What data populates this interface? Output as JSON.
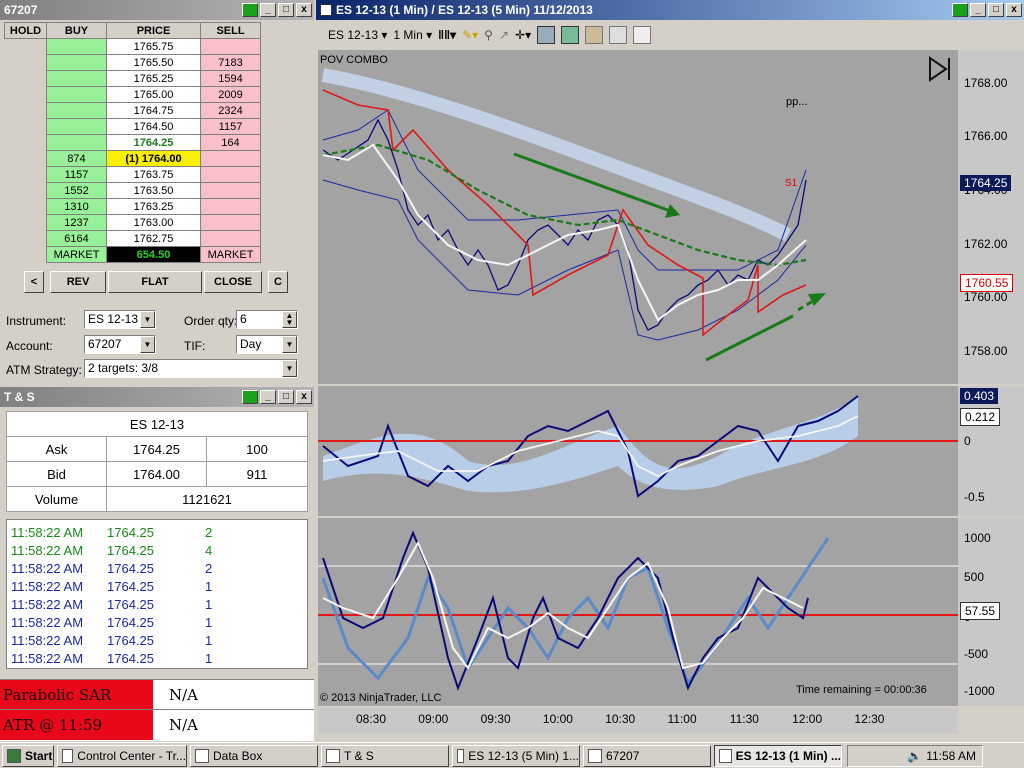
{
  "dom_window": {
    "title": "67207",
    "headers": [
      "HOLD",
      "BUY",
      "PRICE",
      "SELL"
    ],
    "rows": [
      {
        "buy": "",
        "price": "1765.75",
        "sell": ""
      },
      {
        "buy": "",
        "price": "1765.50",
        "sell": "7183"
      },
      {
        "buy": "",
        "price": "1765.25",
        "sell": "1594"
      },
      {
        "buy": "",
        "price": "1765.00",
        "sell": "2009"
      },
      {
        "buy": "",
        "price": "1764.75",
        "sell": "2324"
      },
      {
        "buy": "",
        "price": "1764.50",
        "sell": "1157"
      },
      {
        "buy": "",
        "price": "1764.25",
        "sell": "164"
      },
      {
        "buy": "874",
        "price": "(1) 1764.00",
        "sell": ""
      },
      {
        "buy": "1157",
        "price": "1763.75",
        "sell": ""
      },
      {
        "buy": "1552",
        "price": "1763.50",
        "sell": ""
      },
      {
        "buy": "1310",
        "price": "1763.25",
        "sell": ""
      },
      {
        "buy": "1237",
        "price": "1763.00",
        "sell": ""
      },
      {
        "buy": "6164",
        "price": "1762.75",
        "sell": ""
      }
    ],
    "market_buy": "MARKET",
    "pnl": "654.50",
    "market_sell": "MARKET",
    "buttons": {
      "left": "<",
      "rev": "REV",
      "flat": "FLAT",
      "close": "CLOSE",
      "c": "C"
    },
    "instrument_label": "Instrument:",
    "instrument": "ES 12-13",
    "order_qty_label": "Order qty:",
    "order_qty": "6",
    "account_label": "Account:",
    "account": "67207",
    "tif_label": "TIF:",
    "tif": "Day",
    "atm_label": "ATM Strategy:",
    "atm": "2 targets: 3/8"
  },
  "ts_window": {
    "title": "T & S",
    "instrument": "ES 12-13",
    "ask_label": "Ask",
    "ask_price": "1764.25",
    "ask_size": "100",
    "bid_label": "Bid",
    "bid_price": "1764.00",
    "bid_size": "911",
    "volume_label": "Volume",
    "volume": "1121621",
    "trades": [
      {
        "time": "11:58:22 AM",
        "price": "1764.25",
        "size": "2",
        "color": "#1a8a1a"
      },
      {
        "time": "11:58:22 AM",
        "price": "1764.25",
        "size": "4",
        "color": "#1a8a1a"
      },
      {
        "time": "11:58:22 AM",
        "price": "1764.25",
        "size": "2",
        "color": "#1a2aa0"
      },
      {
        "time": "11:58:22 AM",
        "price": "1764.25",
        "size": "1",
        "color": "#1a2aa0"
      },
      {
        "time": "11:58:22 AM",
        "price": "1764.25",
        "size": "1",
        "color": "#1a2aa0"
      },
      {
        "time": "11:58:22 AM",
        "price": "1764.25",
        "size": "1",
        "color": "#1a2aa0"
      },
      {
        "time": "11:58:22 AM",
        "price": "1764.25",
        "size": "1",
        "color": "#1a2aa0"
      },
      {
        "time": "11:58:22 AM",
        "price": "1764.25",
        "size": "1",
        "color": "#1a2aa0"
      }
    ]
  },
  "databox": {
    "rows": [
      {
        "label": "Parabolic SAR",
        "value": "N/A"
      },
      {
        "label": "ATR @ 11:59",
        "value": "N/A"
      }
    ]
  },
  "chart_window": {
    "title": "ES 12-13 (1 Min) / ES 12-13 (5 Min)  11/12/2013",
    "toolbar": {
      "instrument": "ES 12-13",
      "interval": "1 Min"
    },
    "label_pov": "POV COMBO",
    "label_pp": "pp...",
    "label_s1": "S1",
    "price_ticks": [
      "1768.00",
      "1766.00",
      "1764.00",
      "1762.00",
      "1760.00",
      "1758.00"
    ],
    "last_price": "1764.25",
    "red_price": "1760.55",
    "osc1_ticks": [
      "0",
      "-0.5"
    ],
    "osc1_val1": "0.403",
    "osc1_val2": "0.212",
    "osc2_ticks": [
      "1000",
      "500",
      "0",
      "-500",
      "-1000"
    ],
    "osc2_val": "57.55",
    "time_ticks": [
      "08:30",
      "09:00",
      "09:30",
      "10:00",
      "10:30",
      "11:00",
      "11:30",
      "12:00",
      "12:30"
    ],
    "copyright": "© 2013 NinjaTrader, LLC",
    "time_remaining": "Time remaining = 00:00:36"
  },
  "taskbar": {
    "start": "Start",
    "items": [
      "Control Center - Tr...",
      "Data Box",
      "T & S",
      "ES 12-13 (5 Min)  1...",
      "67207",
      "ES 12-13 (1 Min) ..."
    ],
    "clock": "11:58 AM"
  }
}
